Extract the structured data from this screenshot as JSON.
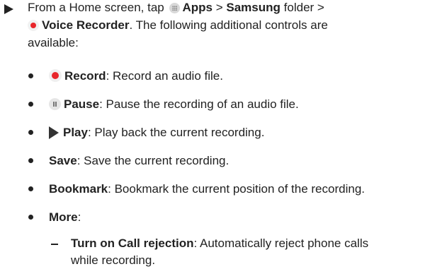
{
  "intro": {
    "line1_prefix": "From a Home screen, tap",
    "apps_label": "Apps",
    "sep1": ">",
    "samsung_label": "Samsung",
    "folder_suffix": "folder >",
    "voice_recorder_label": "Voice Recorder",
    "line2_suffix": ". The following additional controls are",
    "line3": "available:"
  },
  "controls": [
    {
      "icon": "record-icon",
      "label": "Record",
      "desc": ": Record an audio file."
    },
    {
      "icon": "pause-icon",
      "label": "Pause",
      "desc": ": Pause the recording of an audio file."
    },
    {
      "icon": "play-icon",
      "label": "Play",
      "desc": ": Play back the current recording."
    },
    {
      "icon": "",
      "label": "Save",
      "desc": ": Save the current recording."
    },
    {
      "icon": "",
      "label": "Bookmark",
      "desc": ": Bookmark the current position of the recording."
    },
    {
      "icon": "",
      "label": "More",
      "desc": ":"
    }
  ],
  "more_items": [
    {
      "label": "Turn on Call rejection",
      "desc": ": Automatically reject phone calls",
      "desc_line2": "while recording."
    }
  ],
  "colors": {
    "text": "#222222",
    "record_red": "#e8262b"
  }
}
